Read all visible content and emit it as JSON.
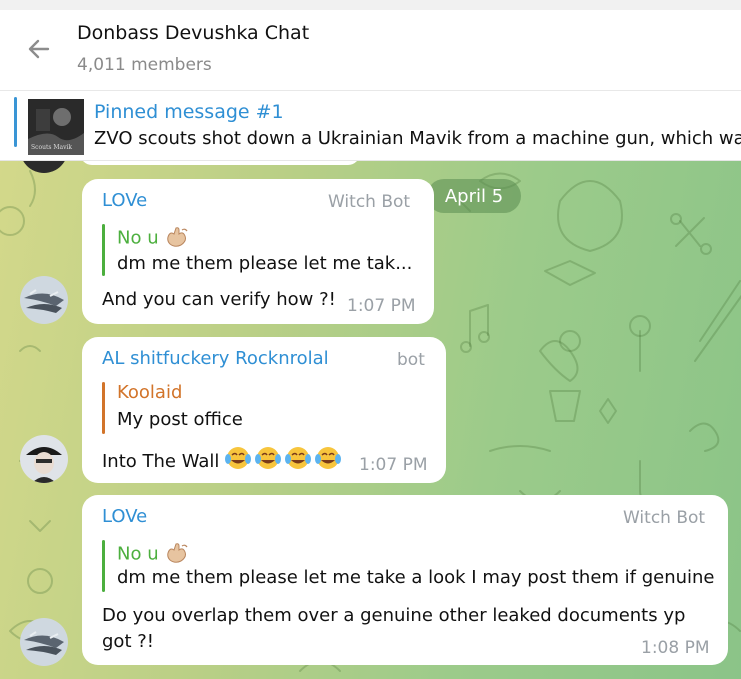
{
  "header": {
    "title": "Donbass Devushka Chat",
    "subtitle": "4,011 members"
  },
  "pinned": {
    "title": "Pinned message #1",
    "text": "ZVO scouts shot down a Ukrainian Mavik from a machine gun, which was",
    "thumb_caption": "Scouts Mavik"
  },
  "date_separator": "April 5",
  "messages": [
    {
      "sender": "LOVe",
      "tag": "Witch Bot",
      "reply_name": "No u",
      "reply_emoji": "call-me-hand-emoji",
      "reply_text": "dm me them please let me tak...",
      "text": "And you can verify how ?!",
      "time": "1:07 PM"
    },
    {
      "sender": "AL shitfuckery Rocknrolal",
      "tag": "bot",
      "reply_name": "Koolaid",
      "reply_text": "My post office",
      "text": "Into The Wall",
      "text_emoji": "laughing-tears-emoji x4",
      "time": "1:07 PM"
    },
    {
      "sender": "LOVe",
      "tag": "Witch Bot",
      "reply_name": "No u",
      "reply_emoji": "call-me-hand-emoji",
      "reply_text": "dm me them please let me take a look I may post them if genuine",
      "text_line1": "Do you overlap them over a genuine other leaked documents yp",
      "text_line2": "got ?!",
      "time": "1:08 PM"
    }
  ],
  "colors": {
    "accent": "#2f8fd4",
    "reply_green": "#4caf3e",
    "reply_orange": "#d2742a",
    "meta_gray": "#9aa0a6"
  }
}
